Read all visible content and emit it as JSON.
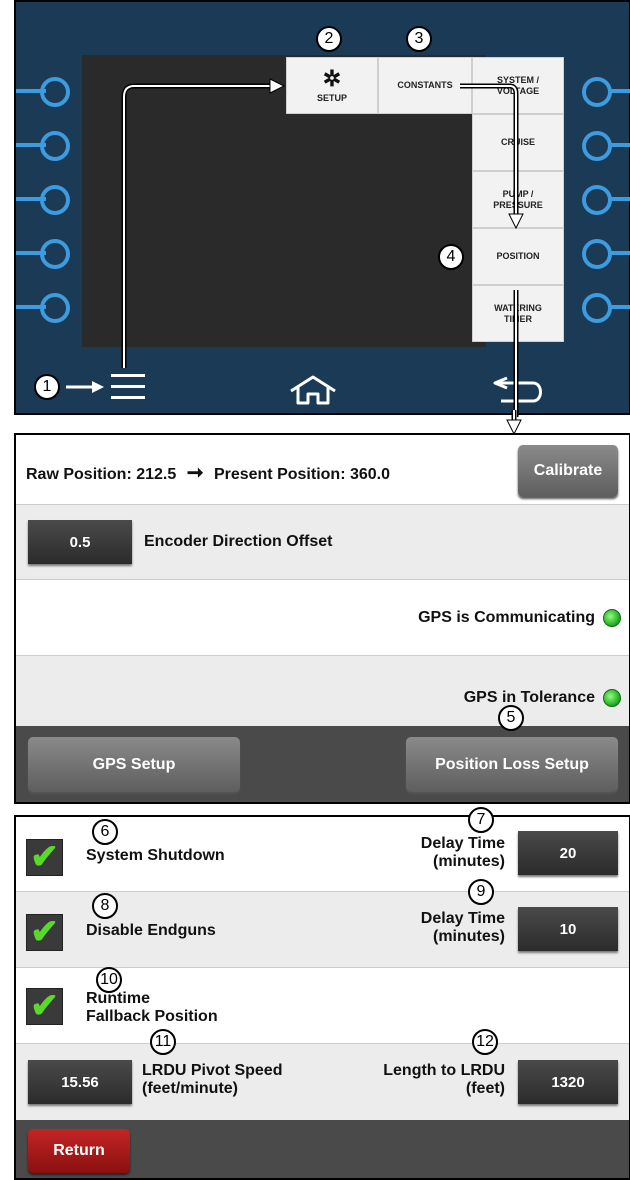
{
  "device": {
    "menu": {
      "setup_label": "SETUP",
      "constants_label": "CONSTANTS",
      "sub_items": [
        {
          "line1": "SYSTEM /",
          "line2": "VOLTAGE"
        },
        {
          "line1": "CRUISE",
          "line2": ""
        },
        {
          "line1": "PUMP /",
          "line2": "PRESSURE"
        },
        {
          "line1": "POSITION",
          "line2": ""
        },
        {
          "line1": "WATERING",
          "line2": "TIMER"
        }
      ]
    },
    "icons": [
      "menu-icon",
      "gear-icon",
      "home-icon",
      "back-icon"
    ],
    "callouts": [
      "1",
      "2",
      "3",
      "4"
    ]
  },
  "position_screen": {
    "raw_label": "Raw Position: 212.5",
    "present_label": "Present Position: 360.0",
    "calibrate_label": "Calibrate",
    "encoder_offset_value": "0.5",
    "encoder_offset_label": "Encoder Direction Offset",
    "gps_communicating_label": "GPS is Communicating",
    "gps_tolerance_label": "GPS in Tolerance",
    "gps_setup_label": "GPS Setup",
    "position_loss_setup_label": "Position Loss Setup",
    "callout": "5",
    "status_color": "#2fb82f"
  },
  "loss_setup": {
    "system_shutdown_label": "System Shutdown",
    "delay_time_label_1a": "Delay Time",
    "delay_time_label_1b": "(minutes)",
    "delay_time_value_1": "20",
    "disable_endguns_label": "Disable Endguns",
    "delay_time_label_2a": "Delay Time",
    "delay_time_label_2b": "(minutes)",
    "delay_time_value_2": "10",
    "runtime_label_a": "Runtime",
    "runtime_label_b": "Fallback Position",
    "pivot_speed_value": "15.56",
    "pivot_speed_label_a": "LRDU Pivot Speed",
    "pivot_speed_label_b": "(feet/minute)",
    "length_label_a": "Length to LRDU",
    "length_label_b": "(feet)",
    "length_value": "1320",
    "return_label": "Return",
    "callouts": [
      "6",
      "7",
      "8",
      "9",
      "10",
      "11",
      "12"
    ]
  }
}
